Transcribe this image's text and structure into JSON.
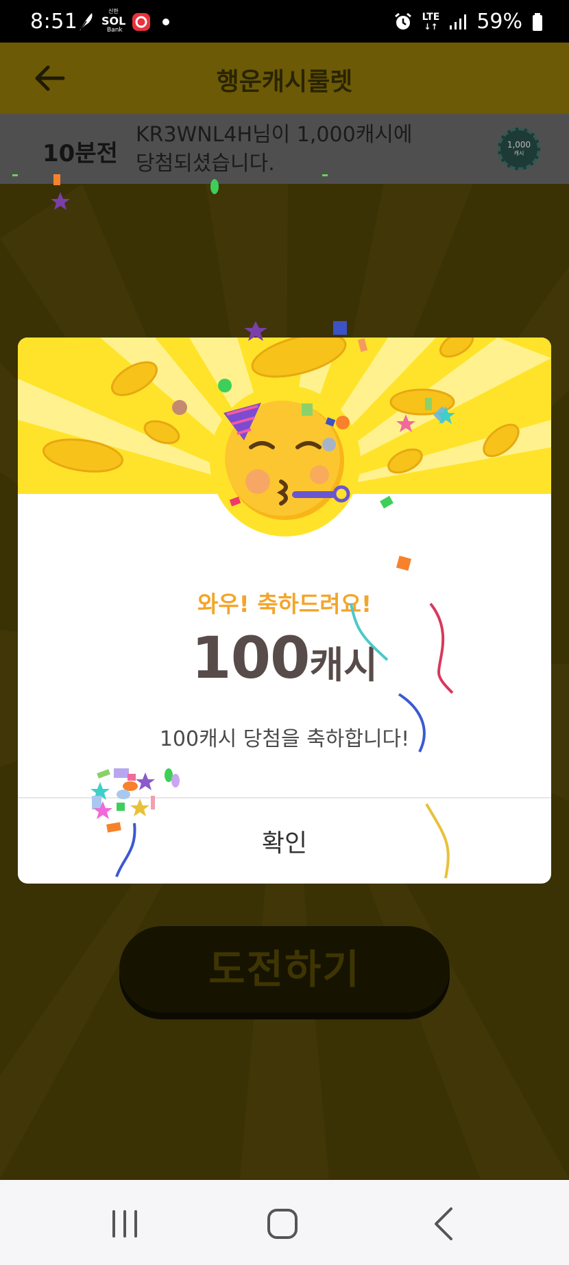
{
  "status_bar": {
    "time": "8:51",
    "app_sol": "SOL",
    "app_sol_sub": "Bank",
    "app_sol_top": "신한",
    "network": "LTE",
    "battery": "59%"
  },
  "header": {
    "title": "행운캐시룰렛"
  },
  "ticker": {
    "ago": "10분전",
    "message": "KR3WNL4H님이 1,000캐시에 당첨되셨습니다.",
    "coin_label": "1,000",
    "coin_sub": "캐시"
  },
  "challenge_button": "도전하기",
  "modal": {
    "subtitle": "와우! 축하드려요!",
    "amount_number": "100",
    "amount_unit": "캐시",
    "description": "100캐시 당첨을 축하합니다!",
    "confirm": "확인"
  },
  "colors": {
    "accent_yellow": "#ffe32a",
    "subtitle_orange": "#f3a52a",
    "amount_text": "#574c4a"
  },
  "icons": [
    "back-arrow-icon",
    "party-face-emoji",
    "recents-icon",
    "home-icon",
    "back-icon",
    "alarm-icon",
    "signal-icon",
    "battery-icon"
  ]
}
